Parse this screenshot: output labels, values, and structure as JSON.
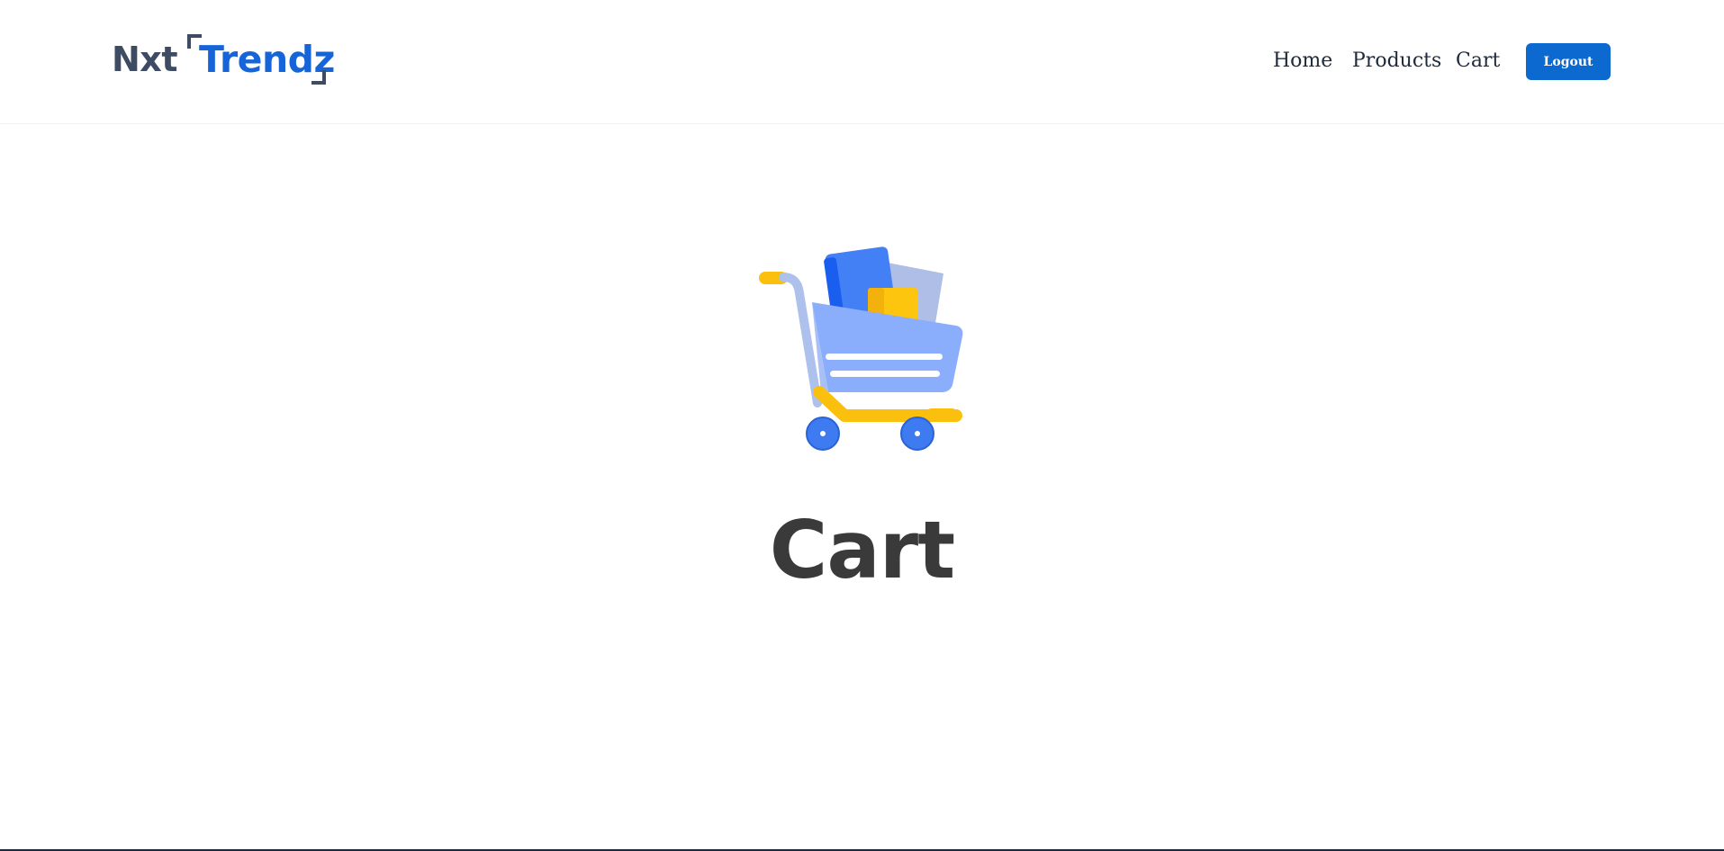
{
  "navbar": {
    "logo": {
      "part1": "Nxt",
      "part2": "Trendz"
    },
    "links": {
      "home": "Home",
      "products": "Products",
      "cart": "Cart"
    },
    "logout_label": "Logout"
  },
  "main": {
    "heading": "Cart",
    "illustration_icon": "shopping-cart-icon"
  },
  "colors": {
    "brand_blue": "#1565d8",
    "logo_dark": "#3e4c63",
    "button_blue": "#0b69cf",
    "heading_text": "#3a3a3a",
    "cart_yellow": "#fbbf0d",
    "cart_blue": "#8aaefb"
  }
}
